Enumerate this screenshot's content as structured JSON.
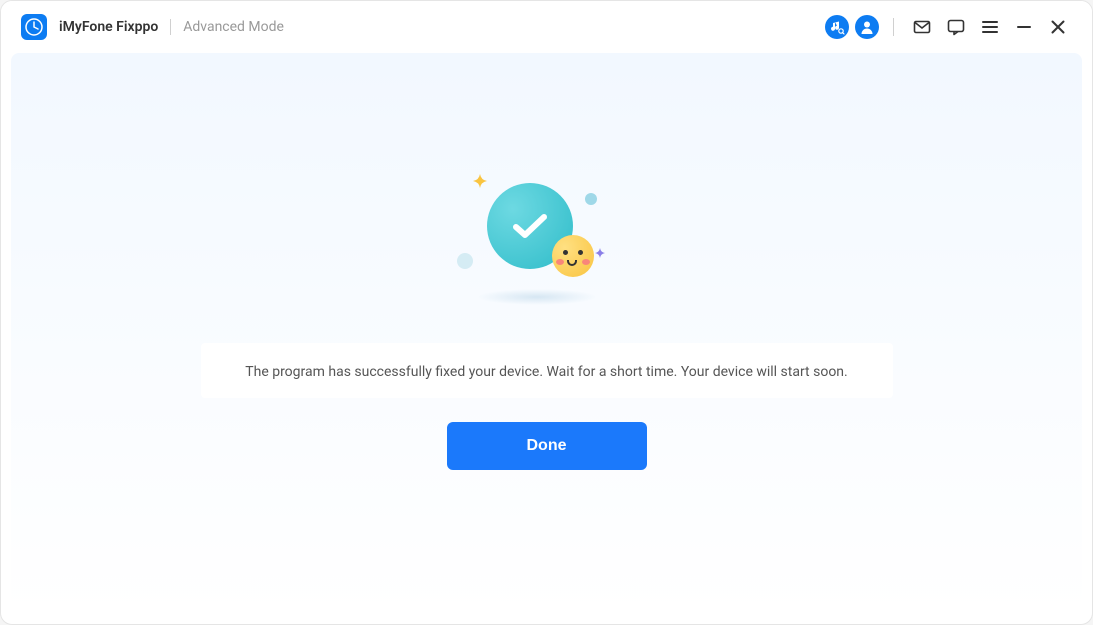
{
  "header": {
    "app_title": "iMyFone Fixppo",
    "mode_label": "Advanced Mode"
  },
  "icons": {
    "music": "music-search-icon",
    "account": "account-icon",
    "mail": "mail-icon",
    "chat": "chat-icon",
    "menu": "menu-icon",
    "minimize": "minimize-icon",
    "close": "close-icon"
  },
  "content": {
    "message": "The program has successfully fixed your device. Wait for a short time. Your device will start soon.",
    "done_button": "Done"
  },
  "colors": {
    "primary": "#1b79fb",
    "accent_circle": "#0d7cf2",
    "success_gradient_start": "#6dd9e2",
    "success_gradient_end": "#2fbcc9"
  }
}
